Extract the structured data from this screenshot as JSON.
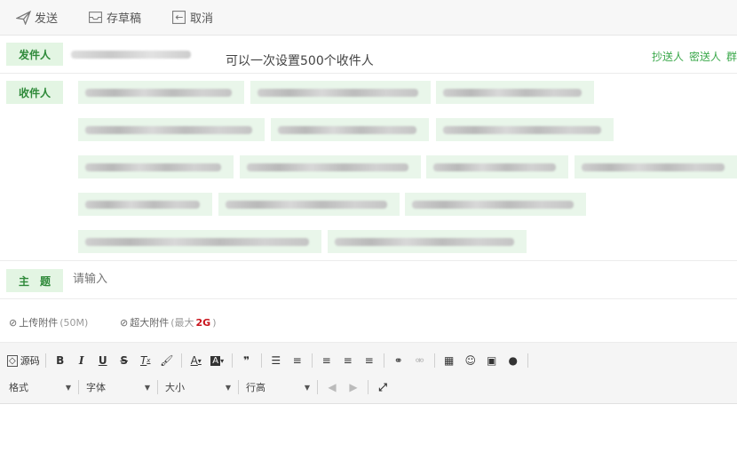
{
  "toolbar": {
    "send": "发送",
    "draft": "存草稿",
    "cancel": "取消"
  },
  "sender": {
    "label": "发件人",
    "hint": "可以一次设置500个收件人",
    "cc": "抄送人",
    "bcc": "密送人",
    "more": "群"
  },
  "recipients": {
    "label": "收件人"
  },
  "subject": {
    "label": "主　题",
    "placeholder": "请输入"
  },
  "attachments": {
    "upload": "上传附件",
    "upload_limit": "(50M)",
    "large": "超大附件",
    "large_limit_prefix": "(最大",
    "large_limit_value": "2G",
    "large_limit_suffix": ")"
  },
  "editor": {
    "source": "源码",
    "bold": "B",
    "italic": "I",
    "underline": "U",
    "strike": "S",
    "quote": "❞",
    "format": "格式",
    "font": "字体",
    "size": "大小",
    "line_height": "行高"
  },
  "colors": {
    "accent": "#3aa84a",
    "label_bg": "#e3f5e3",
    "danger": "#c9141c"
  }
}
